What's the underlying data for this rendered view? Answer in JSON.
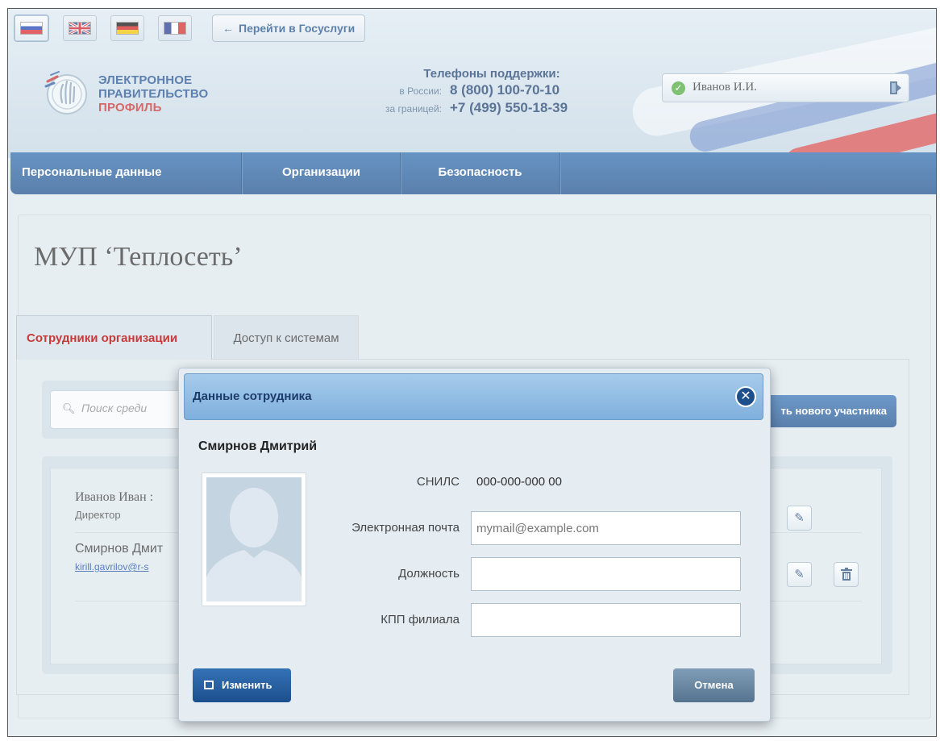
{
  "header": {
    "languages": [
      {
        "code": "ru",
        "icon": "flag-russia-icon",
        "active": true
      },
      {
        "code": "en",
        "icon": "flag-uk-icon",
        "active": false
      },
      {
        "code": "de",
        "icon": "flag-germany-icon",
        "active": false
      },
      {
        "code": "fr",
        "icon": "flag-france-icon",
        "active": false
      }
    ],
    "gosuslugi_button": "Перейти в Госуслуги",
    "logo": {
      "line1": "ЭЛЕКТРОННОЕ",
      "line2": "ПРАВИТЕЛЬСТВО",
      "line3": "ПРОФИЛЬ"
    },
    "support": {
      "title": "Телефоны поддержки:",
      "russia_label": "в России:",
      "russia_phone": "8 (800) 100-70-10",
      "abroad_label": "за границей:",
      "abroad_phone": "+7 (499) 550-18-39"
    },
    "user": {
      "name": "Иванов И.И.",
      "status_icon": "check-icon",
      "logout_icon": "logout-icon"
    }
  },
  "nav": {
    "items": [
      {
        "label": "Персональные данные"
      },
      {
        "label": "Организации"
      },
      {
        "label": "Безопасность"
      }
    ]
  },
  "page": {
    "title": "МУП ‘Теплосеть’",
    "tabs": [
      {
        "label": "Сотрудники организации",
        "active": true
      },
      {
        "label": "Доступ к системам",
        "active": false
      }
    ],
    "search_placeholder": "Поиск среди",
    "add_member_button": "ть нового участника",
    "staff": [
      {
        "name": "Иванов Иван :",
        "subtitle": "Директор"
      },
      {
        "name": "Смирнов Дмит",
        "email": "kirill.gavrilov@r-s"
      }
    ]
  },
  "modal": {
    "title": "Данные сотрудника",
    "person_name": "Смирнов Дмитрий",
    "snils_label": "СНИЛС",
    "snils_value": "000-000-000 00",
    "email_label": "Электронная почта",
    "email_placeholder": "mymail@example.com",
    "position_label": "Должность",
    "position_value": "",
    "kpp_label": "КПП филиала",
    "kpp_value": "",
    "edit_button": "Изменить",
    "cancel_button": "Отмена"
  },
  "colors": {
    "nav_blue": "#1f5695",
    "accent_red": "#c83a3a",
    "button_blue": "#24599a",
    "cancel_gray": "#6a879f"
  }
}
